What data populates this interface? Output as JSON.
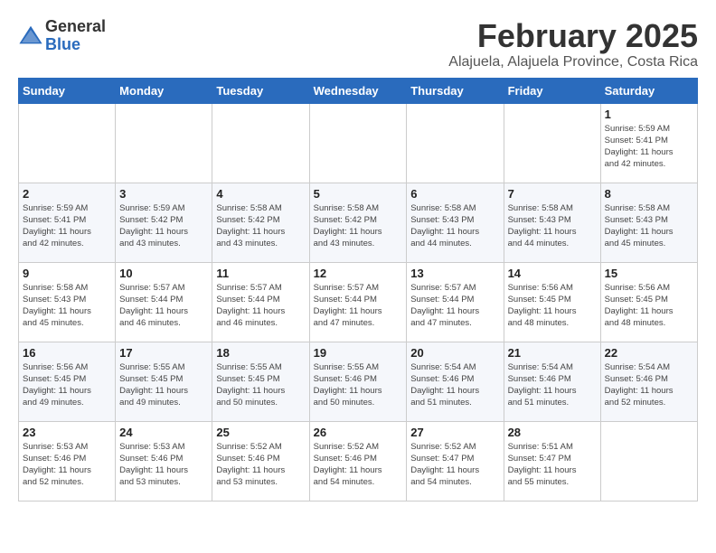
{
  "logo": {
    "general": "General",
    "blue": "Blue"
  },
  "header": {
    "month": "February 2025",
    "location": "Alajuela, Alajuela Province, Costa Rica"
  },
  "weekdays": [
    "Sunday",
    "Monday",
    "Tuesday",
    "Wednesday",
    "Thursday",
    "Friday",
    "Saturday"
  ],
  "weeks": [
    [
      {
        "day": "",
        "info": ""
      },
      {
        "day": "",
        "info": ""
      },
      {
        "day": "",
        "info": ""
      },
      {
        "day": "",
        "info": ""
      },
      {
        "day": "",
        "info": ""
      },
      {
        "day": "",
        "info": ""
      },
      {
        "day": "1",
        "info": "Sunrise: 5:59 AM\nSunset: 5:41 PM\nDaylight: 11 hours\nand 42 minutes."
      }
    ],
    [
      {
        "day": "2",
        "info": "Sunrise: 5:59 AM\nSunset: 5:41 PM\nDaylight: 11 hours\nand 42 minutes."
      },
      {
        "day": "3",
        "info": "Sunrise: 5:59 AM\nSunset: 5:42 PM\nDaylight: 11 hours\nand 43 minutes."
      },
      {
        "day": "4",
        "info": "Sunrise: 5:58 AM\nSunset: 5:42 PM\nDaylight: 11 hours\nand 43 minutes."
      },
      {
        "day": "5",
        "info": "Sunrise: 5:58 AM\nSunset: 5:42 PM\nDaylight: 11 hours\nand 43 minutes."
      },
      {
        "day": "6",
        "info": "Sunrise: 5:58 AM\nSunset: 5:43 PM\nDaylight: 11 hours\nand 44 minutes."
      },
      {
        "day": "7",
        "info": "Sunrise: 5:58 AM\nSunset: 5:43 PM\nDaylight: 11 hours\nand 44 minutes."
      },
      {
        "day": "8",
        "info": "Sunrise: 5:58 AM\nSunset: 5:43 PM\nDaylight: 11 hours\nand 45 minutes."
      }
    ],
    [
      {
        "day": "9",
        "info": "Sunrise: 5:58 AM\nSunset: 5:43 PM\nDaylight: 11 hours\nand 45 minutes."
      },
      {
        "day": "10",
        "info": "Sunrise: 5:57 AM\nSunset: 5:44 PM\nDaylight: 11 hours\nand 46 minutes."
      },
      {
        "day": "11",
        "info": "Sunrise: 5:57 AM\nSunset: 5:44 PM\nDaylight: 11 hours\nand 46 minutes."
      },
      {
        "day": "12",
        "info": "Sunrise: 5:57 AM\nSunset: 5:44 PM\nDaylight: 11 hours\nand 47 minutes."
      },
      {
        "day": "13",
        "info": "Sunrise: 5:57 AM\nSunset: 5:44 PM\nDaylight: 11 hours\nand 47 minutes."
      },
      {
        "day": "14",
        "info": "Sunrise: 5:56 AM\nSunset: 5:45 PM\nDaylight: 11 hours\nand 48 minutes."
      },
      {
        "day": "15",
        "info": "Sunrise: 5:56 AM\nSunset: 5:45 PM\nDaylight: 11 hours\nand 48 minutes."
      }
    ],
    [
      {
        "day": "16",
        "info": "Sunrise: 5:56 AM\nSunset: 5:45 PM\nDaylight: 11 hours\nand 49 minutes."
      },
      {
        "day": "17",
        "info": "Sunrise: 5:55 AM\nSunset: 5:45 PM\nDaylight: 11 hours\nand 49 minutes."
      },
      {
        "day": "18",
        "info": "Sunrise: 5:55 AM\nSunset: 5:45 PM\nDaylight: 11 hours\nand 50 minutes."
      },
      {
        "day": "19",
        "info": "Sunrise: 5:55 AM\nSunset: 5:46 PM\nDaylight: 11 hours\nand 50 minutes."
      },
      {
        "day": "20",
        "info": "Sunrise: 5:54 AM\nSunset: 5:46 PM\nDaylight: 11 hours\nand 51 minutes."
      },
      {
        "day": "21",
        "info": "Sunrise: 5:54 AM\nSunset: 5:46 PM\nDaylight: 11 hours\nand 51 minutes."
      },
      {
        "day": "22",
        "info": "Sunrise: 5:54 AM\nSunset: 5:46 PM\nDaylight: 11 hours\nand 52 minutes."
      }
    ],
    [
      {
        "day": "23",
        "info": "Sunrise: 5:53 AM\nSunset: 5:46 PM\nDaylight: 11 hours\nand 52 minutes."
      },
      {
        "day": "24",
        "info": "Sunrise: 5:53 AM\nSunset: 5:46 PM\nDaylight: 11 hours\nand 53 minutes."
      },
      {
        "day": "25",
        "info": "Sunrise: 5:52 AM\nSunset: 5:46 PM\nDaylight: 11 hours\nand 53 minutes."
      },
      {
        "day": "26",
        "info": "Sunrise: 5:52 AM\nSunset: 5:46 PM\nDaylight: 11 hours\nand 54 minutes."
      },
      {
        "day": "27",
        "info": "Sunrise: 5:52 AM\nSunset: 5:47 PM\nDaylight: 11 hours\nand 54 minutes."
      },
      {
        "day": "28",
        "info": "Sunrise: 5:51 AM\nSunset: 5:47 PM\nDaylight: 11 hours\nand 55 minutes."
      },
      {
        "day": "",
        "info": ""
      }
    ]
  ]
}
